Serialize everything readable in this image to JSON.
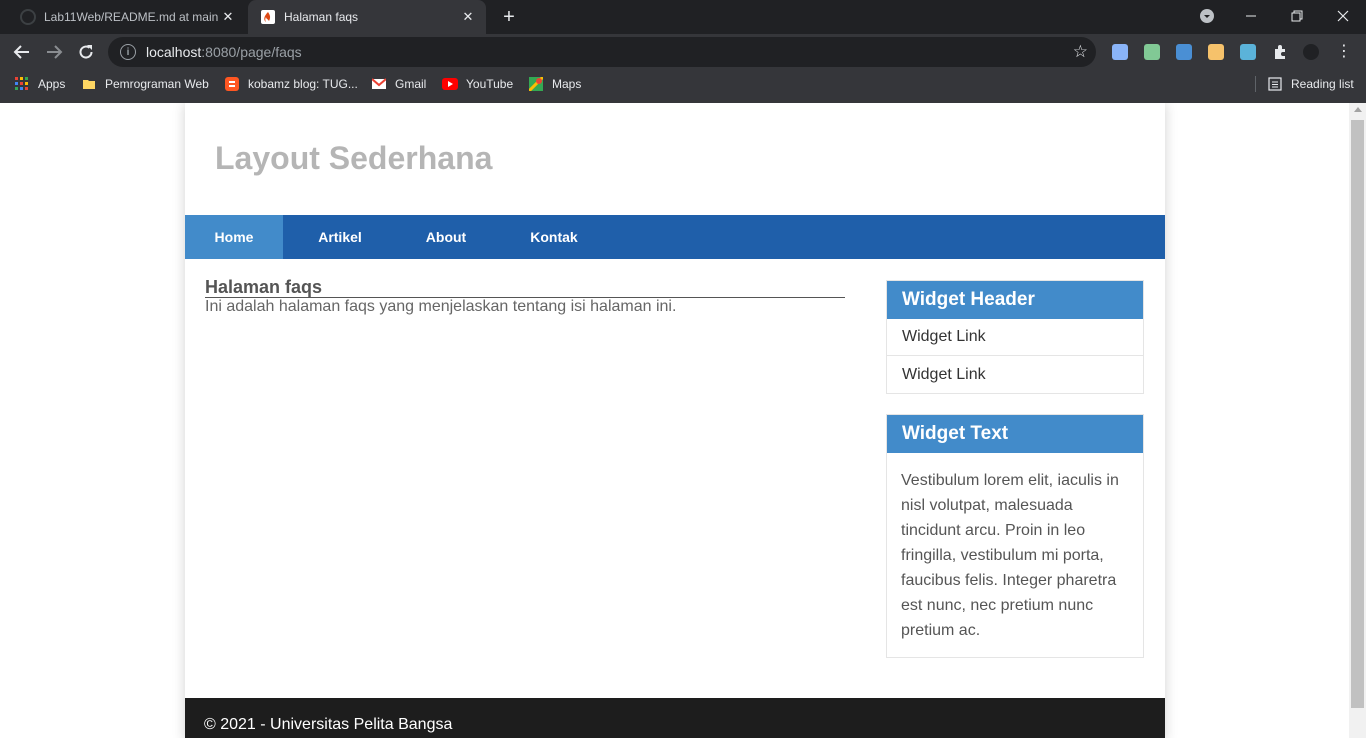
{
  "browser": {
    "tabs": [
      {
        "title": "Lab11Web/README.md at main",
        "favicon": "github-icon",
        "active": false
      },
      {
        "title": "Halaman faqs",
        "favicon": "codeigniter-icon",
        "active": true
      }
    ],
    "url": {
      "host": "localhost",
      "rest": ":8080/page/faqs"
    },
    "bookmarks": [
      {
        "label": "Apps",
        "icon": "apps-grid-icon"
      },
      {
        "label": "Pemrograman Web",
        "icon": "folder-icon"
      },
      {
        "label": "kobamz blog: TUG...",
        "icon": "blogger-icon"
      },
      {
        "label": "Gmail",
        "icon": "gmail-icon"
      },
      {
        "label": "YouTube",
        "icon": "youtube-icon"
      },
      {
        "label": "Maps",
        "icon": "maps-icon"
      }
    ],
    "reading_list": "Reading list"
  },
  "site": {
    "title": "Layout Sederhana",
    "nav": [
      {
        "label": "Home",
        "active": true
      },
      {
        "label": "Artikel",
        "active": false
      },
      {
        "label": "About",
        "active": false
      },
      {
        "label": "Kontak",
        "active": false
      }
    ],
    "main": {
      "heading": "Halaman faqs",
      "text": "Ini adalah halaman faqs yang menjelaskan tentang isi halaman ini."
    },
    "widgets": [
      {
        "header": "Widget Header",
        "links": [
          "Widget Link",
          "Widget Link"
        ]
      },
      {
        "header": "Widget Text",
        "text": "Vestibulum lorem elit, iaculis in nisl volutpat, malesuada tincidunt arcu. Proin in leo fringilla, vestibulum mi porta, faucibus felis. Integer pharetra est nunc, nec pretium nunc pretium ac."
      }
    ],
    "footer": "© 2021 - Universitas Pelita Bangsa"
  },
  "colors": {
    "nav_bg": "#1f5faa",
    "nav_active": "#428bca",
    "widget_header": "#428bca",
    "footer_bg": "#1d1d1d",
    "title": "#b5b5b5"
  }
}
